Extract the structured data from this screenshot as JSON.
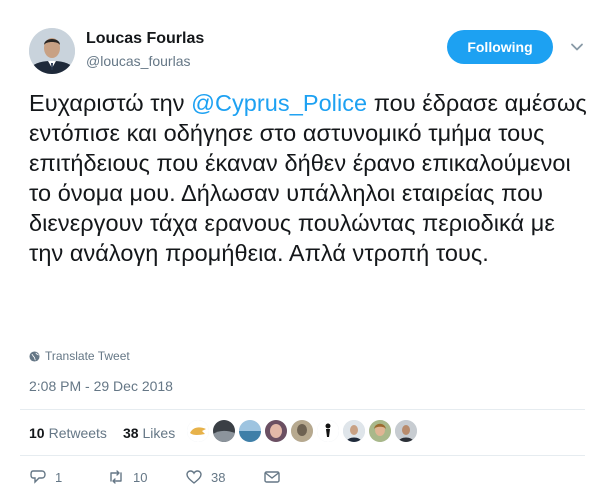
{
  "author": {
    "name": "Loucas Fourlas",
    "handle": "@loucas_fourlas"
  },
  "follow_button": {
    "label": "Following"
  },
  "tweet": {
    "text_before": "Ευχαριστώ την ",
    "mention": "@Cyprus_Police",
    "text_after": " που έδρασε αμέσως εντόπισε και οδήγησε στο αστυνομικό τμήμα τους επιτήδειους που έκαναν δήθεν έρανο επικαλούμενοι το όνομα μου. Δήλωσαν υπάλληλοι εταιρείας που διενεργουν τάχα ερανους πουλώντας περιοδικά με την ανάλογη προμήθεια. Απλά ντροπή τους."
  },
  "translate_label": "Translate Tweet",
  "timestamp": "2:08 PM - 29 Dec 2018",
  "stats": {
    "retweets_count": "10",
    "retweets_label": "Retweets",
    "likes_count": "38",
    "likes_label": "Likes"
  },
  "actions": {
    "reply_count": "1",
    "retweet_count": "10",
    "like_count": "38"
  },
  "colors": {
    "accent": "#1da1f2",
    "text": "#14171a",
    "muted": "#657786",
    "retweet": "#17bf63",
    "like": "#e0245e"
  }
}
